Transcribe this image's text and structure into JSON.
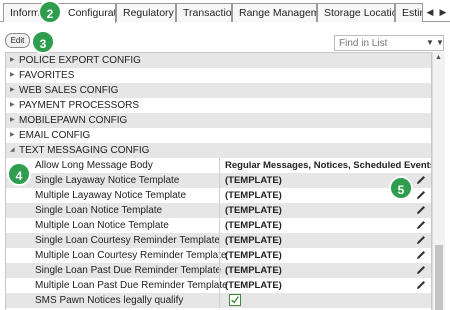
{
  "tabs": [
    {
      "label": "Information"
    },
    {
      "label": "Configuration"
    },
    {
      "label": "Regulatory"
    },
    {
      "label": "Transaction"
    },
    {
      "label": "Range Management"
    },
    {
      "label": "Storage Locations"
    },
    {
      "label": "Estimates"
    }
  ],
  "active_tab": "Configuration",
  "toolbar": {
    "edit_label": "Edit"
  },
  "search": {
    "placeholder": "Find in List"
  },
  "callouts": [
    "2",
    "3",
    "4",
    "5"
  ],
  "groups": [
    {
      "label": "POLICE EXPORT CONFIG"
    },
    {
      "label": "FAVORITES"
    },
    {
      "label": "WEB SALES CONFIG"
    },
    {
      "label": "PAYMENT PROCESSORS"
    },
    {
      "label": "MOBILEPAWN CONFIG"
    },
    {
      "label": "EMAIL CONFIG"
    },
    {
      "label": "TEXT MESSAGING CONFIG"
    }
  ],
  "settings": [
    {
      "label": "Allow Long Message Body",
      "value": "Regular Messages, Notices, Scheduled Events"
    },
    {
      "label": "Single Layaway Notice Template",
      "value": "(TEMPLATE)"
    },
    {
      "label": "Multiple Layaway Notice Template",
      "value": "(TEMPLATE)"
    },
    {
      "label": "Single Loan Notice Template",
      "value": "(TEMPLATE)"
    },
    {
      "label": "Multiple Loan Notice Template",
      "value": "(TEMPLATE)"
    },
    {
      "label": "Single Loan Courtesy Reminder Template",
      "value": "(TEMPLATE)"
    },
    {
      "label": "Multiple Loan Courtesy Reminder Template",
      "value": "(TEMPLATE)"
    },
    {
      "label": "Single Loan Past Due Reminder Template",
      "value": "(TEMPLATE)"
    },
    {
      "label": "Multiple Loan Past Due Reminder Template",
      "value": "(TEMPLATE)"
    },
    {
      "label": "SMS Pawn Notices legally qualify",
      "checked": true
    }
  ],
  "colors": {
    "callout": "#2e9e4e",
    "row_shade": "#e6e6e6",
    "checkbox": "#3b8a3b"
  }
}
